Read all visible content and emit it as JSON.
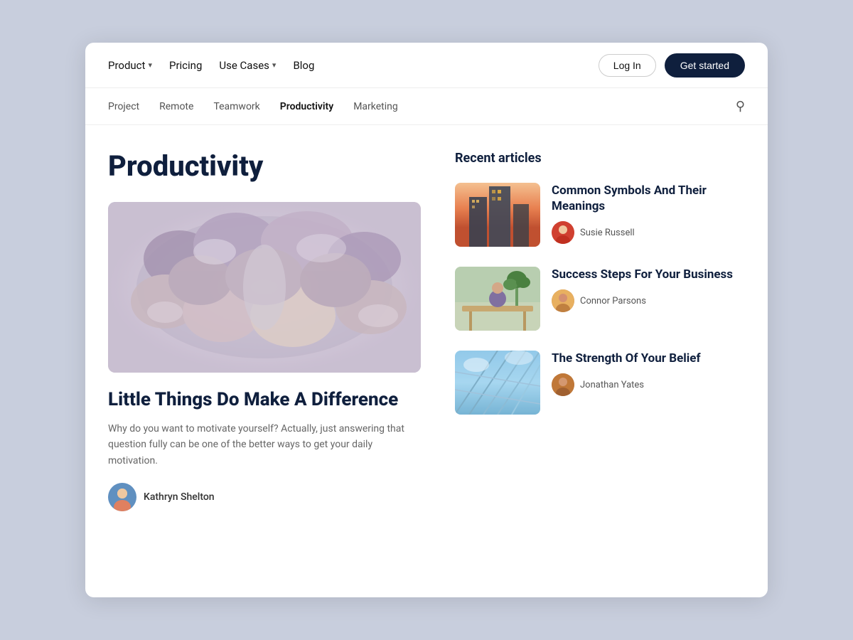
{
  "nav": {
    "items": [
      {
        "label": "Product",
        "has_dropdown": true
      },
      {
        "label": "Pricing",
        "has_dropdown": false
      },
      {
        "label": "Use Cases",
        "has_dropdown": true
      },
      {
        "label": "Blog",
        "has_dropdown": false
      }
    ],
    "login_label": "Log In",
    "started_label": "Get started"
  },
  "categories": {
    "items": [
      {
        "label": "Project",
        "active": false
      },
      {
        "label": "Remote",
        "active": false
      },
      {
        "label": "Teamwork",
        "active": false
      },
      {
        "label": "Productivity",
        "active": true
      },
      {
        "label": "Marketing",
        "active": false
      }
    ]
  },
  "page": {
    "title": "Productivity"
  },
  "featured": {
    "title": "Little Things Do Make A Difference",
    "excerpt": "Why do you want to motivate yourself? Actually, just answering that question fully can be one of the better ways to get your daily motivation.",
    "author": "Kathryn Shelton"
  },
  "recent": {
    "section_title": "Recent articles",
    "articles": [
      {
        "title": "Common Symbols And Their Meanings",
        "author": "Susie Russell"
      },
      {
        "title": "Success Steps For Your Business",
        "author": "Connor Parsons"
      },
      {
        "title": "The Strength Of Your Belief",
        "author": "Jonathan Yates"
      }
    ]
  }
}
